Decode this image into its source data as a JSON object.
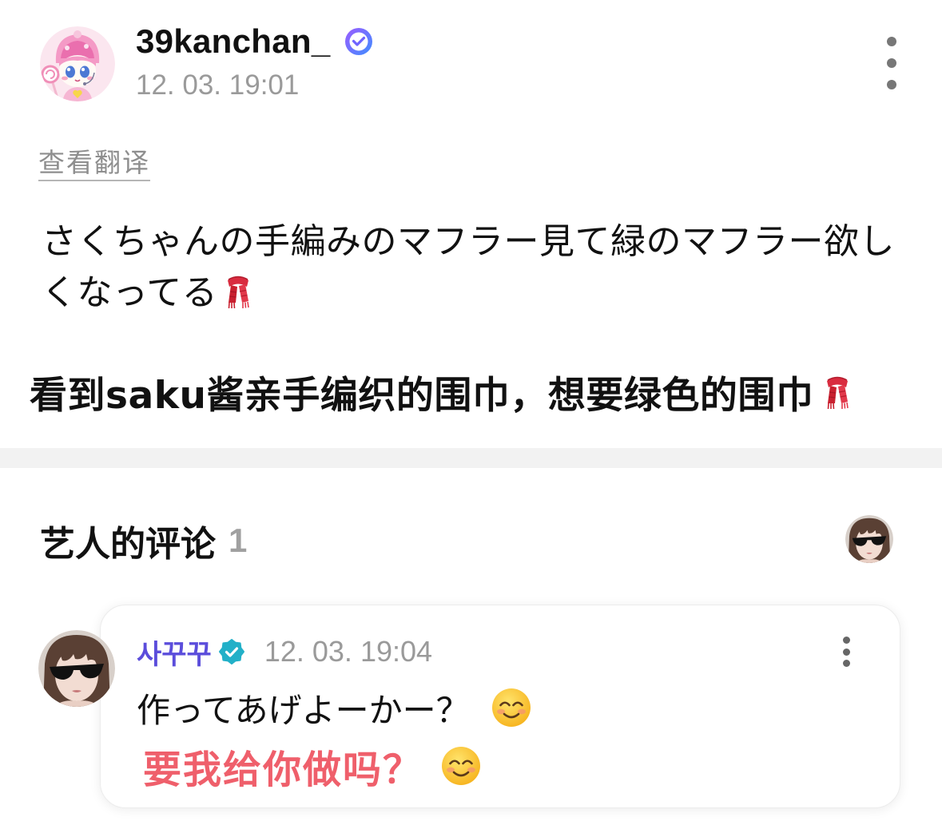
{
  "post": {
    "author": {
      "username": "39kanchan_",
      "avatar_icon": "cartoon-girl-avatar",
      "badge_icon": "verified-badge-icon"
    },
    "timestamp": "12. 03. 19:01",
    "more_icon": "more-vertical-icon",
    "translate_link": "查看翻译",
    "body": "さくちゃんの手編みのマフラー見て緑のマフラー欲しくなってる",
    "body_emoji": "scarf-emoji",
    "translation": "看到saku酱亲手编织的围巾，想要绿色的围巾",
    "translation_emoji": "scarf-emoji"
  },
  "artist_comments": {
    "title": "艺人的评论",
    "count": "1",
    "preview_avatar_icon": "artist-avatar",
    "comments": [
      {
        "author": "사꾸꾸",
        "avatar_icon": "artist-avatar",
        "badge_icon": "artist-verified-badge-icon",
        "timestamp": "12. 03. 19:04",
        "more_icon": "more-vertical-icon",
        "text": "作ってあげよーかー？",
        "text_emoji": "smiling-face-emoji",
        "translation": "要我给你做吗？",
        "translation_emoji": "smiling-face-emoji"
      }
    ]
  },
  "colors": {
    "text": "#111111",
    "muted": "#9a9a9a",
    "artist_name": "#5b4ddb",
    "translation_highlight": "#ef5f6b",
    "artist_badge": "#22b0c8",
    "separator": "#f2f2f2"
  }
}
